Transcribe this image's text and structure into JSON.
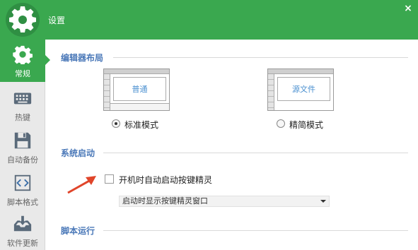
{
  "window": {
    "title": "设置",
    "close_glyph": "×",
    "accent_color": "#3aa84f"
  },
  "sidebar": {
    "items": [
      {
        "label": "常规",
        "icon": "gear-icon",
        "active": true
      },
      {
        "label": "热键",
        "icon": "keyboard-icon",
        "active": false
      },
      {
        "label": "自动备份",
        "icon": "floppy-disk-icon",
        "active": false
      },
      {
        "label": "脚本格式",
        "icon": "code-brackets-icon",
        "active": false
      },
      {
        "label": "软件更新",
        "icon": "download-tray-icon",
        "active": false
      }
    ]
  },
  "editor_layout": {
    "title": "编辑器布局",
    "options": [
      {
        "preview_text": "普通",
        "label": "标准模式",
        "selected": true
      },
      {
        "preview_text": "源文件",
        "label": "精简模式",
        "selected": false
      }
    ]
  },
  "startup": {
    "title": "系统启动",
    "auto_start_label": "开机时自动启动按键精灵",
    "auto_start_checked": false,
    "startup_window_select": "启动时显示按键精灵窗口"
  },
  "script_run": {
    "title": "脚本运行"
  }
}
